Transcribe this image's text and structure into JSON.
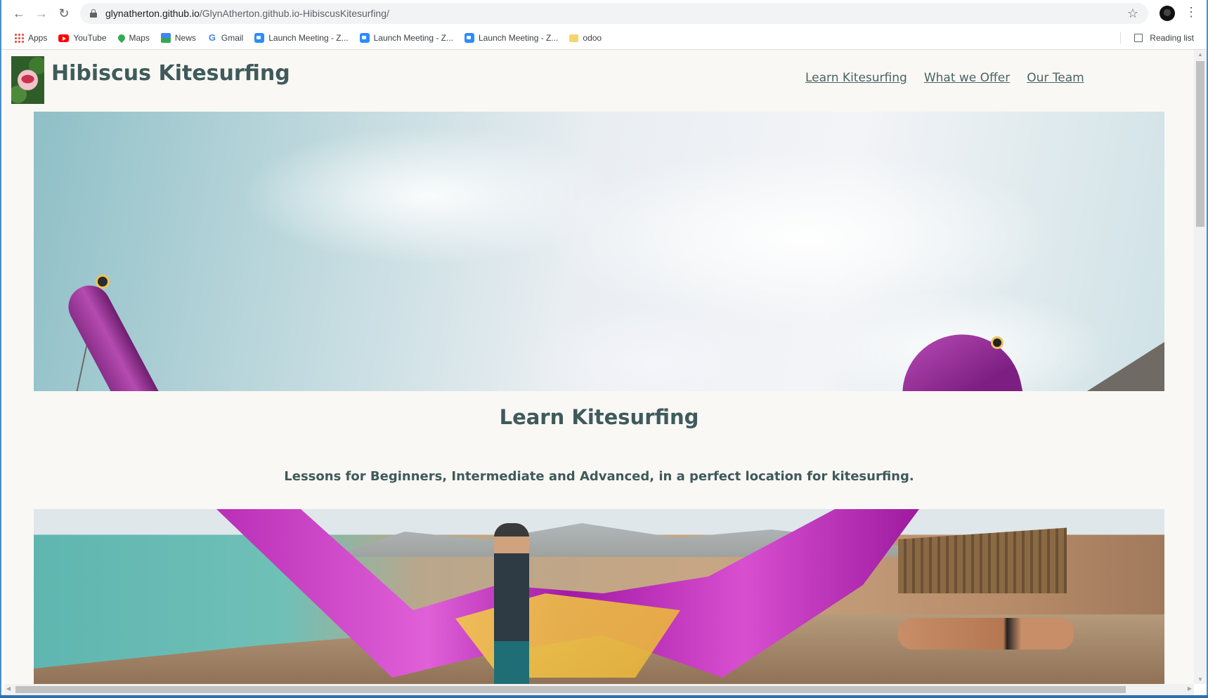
{
  "browser": {
    "url_host": "glynatherton.github.io",
    "url_path": "/GlynAtherton.github.io-HibiscusKitesurfing/",
    "back_icon": "arrow-left-icon",
    "forward_icon": "arrow-right-icon",
    "reload_icon": "reload-icon",
    "bookmarks": [
      {
        "label": "Apps",
        "icon": "apps-grid-icon"
      },
      {
        "label": "YouTube",
        "icon": "youtube-icon"
      },
      {
        "label": "Maps",
        "icon": "maps-pin-icon"
      },
      {
        "label": "News",
        "icon": "news-icon"
      },
      {
        "label": "Gmail",
        "icon": "google-icon"
      },
      {
        "label": "Launch Meeting - Z...",
        "icon": "zoom-icon"
      },
      {
        "label": "Launch Meeting - Z...",
        "icon": "zoom-icon"
      },
      {
        "label": "Launch Meeting - Z...",
        "icon": "zoom-icon"
      },
      {
        "label": "odoo",
        "icon": "folder-icon"
      }
    ],
    "reading_list": "Reading list"
  },
  "site": {
    "title": "Hibiscus Kitesurfing",
    "nav": [
      "Learn Kitesurfing",
      "What we Offer",
      "Our Team"
    ],
    "section_title": "Learn Kitesurfing",
    "section_subtitle": "Lessons for Beginners, Intermediate and Advanced, in a perfect location for kitesurfing."
  },
  "colors": {
    "page_background": "#f9f8f5",
    "heading_text": "#3f5a5a",
    "kite_purple": "#b548b4"
  }
}
